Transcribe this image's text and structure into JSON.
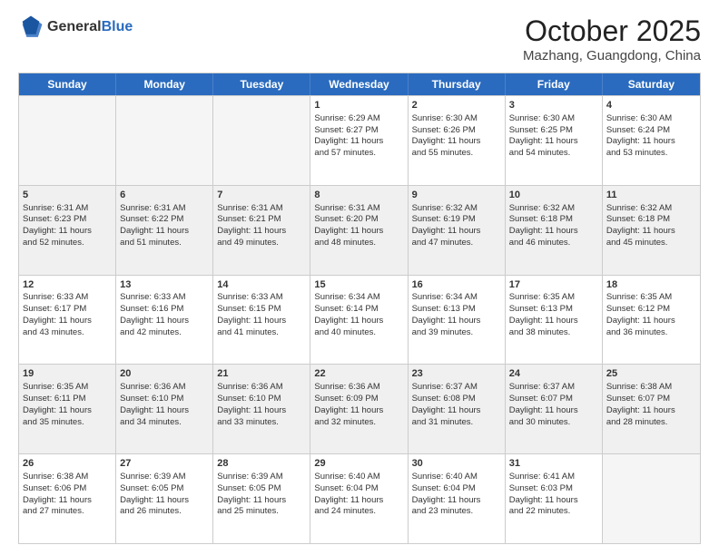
{
  "header": {
    "logo_general": "General",
    "logo_blue": "Blue",
    "month_title": "October 2025",
    "location": "Mazhang, Guangdong, China"
  },
  "weekdays": [
    "Sunday",
    "Monday",
    "Tuesday",
    "Wednesday",
    "Thursday",
    "Friday",
    "Saturday"
  ],
  "rows": [
    [
      {
        "day": "",
        "info": "",
        "empty": true
      },
      {
        "day": "",
        "info": "",
        "empty": true
      },
      {
        "day": "",
        "info": "",
        "empty": true
      },
      {
        "day": "1",
        "info": "Sunrise: 6:29 AM\nSunset: 6:27 PM\nDaylight: 11 hours\nand 57 minutes.",
        "empty": false
      },
      {
        "day": "2",
        "info": "Sunrise: 6:30 AM\nSunset: 6:26 PM\nDaylight: 11 hours\nand 55 minutes.",
        "empty": false
      },
      {
        "day": "3",
        "info": "Sunrise: 6:30 AM\nSunset: 6:25 PM\nDaylight: 11 hours\nand 54 minutes.",
        "empty": false
      },
      {
        "day": "4",
        "info": "Sunrise: 6:30 AM\nSunset: 6:24 PM\nDaylight: 11 hours\nand 53 minutes.",
        "empty": false
      }
    ],
    [
      {
        "day": "5",
        "info": "Sunrise: 6:31 AM\nSunset: 6:23 PM\nDaylight: 11 hours\nand 52 minutes.",
        "empty": false
      },
      {
        "day": "6",
        "info": "Sunrise: 6:31 AM\nSunset: 6:22 PM\nDaylight: 11 hours\nand 51 minutes.",
        "empty": false
      },
      {
        "day": "7",
        "info": "Sunrise: 6:31 AM\nSunset: 6:21 PM\nDaylight: 11 hours\nand 49 minutes.",
        "empty": false
      },
      {
        "day": "8",
        "info": "Sunrise: 6:31 AM\nSunset: 6:20 PM\nDaylight: 11 hours\nand 48 minutes.",
        "empty": false
      },
      {
        "day": "9",
        "info": "Sunrise: 6:32 AM\nSunset: 6:19 PM\nDaylight: 11 hours\nand 47 minutes.",
        "empty": false
      },
      {
        "day": "10",
        "info": "Sunrise: 6:32 AM\nSunset: 6:18 PM\nDaylight: 11 hours\nand 46 minutes.",
        "empty": false
      },
      {
        "day": "11",
        "info": "Sunrise: 6:32 AM\nSunset: 6:18 PM\nDaylight: 11 hours\nand 45 minutes.",
        "empty": false
      }
    ],
    [
      {
        "day": "12",
        "info": "Sunrise: 6:33 AM\nSunset: 6:17 PM\nDaylight: 11 hours\nand 43 minutes.",
        "empty": false
      },
      {
        "day": "13",
        "info": "Sunrise: 6:33 AM\nSunset: 6:16 PM\nDaylight: 11 hours\nand 42 minutes.",
        "empty": false
      },
      {
        "day": "14",
        "info": "Sunrise: 6:33 AM\nSunset: 6:15 PM\nDaylight: 11 hours\nand 41 minutes.",
        "empty": false
      },
      {
        "day": "15",
        "info": "Sunrise: 6:34 AM\nSunset: 6:14 PM\nDaylight: 11 hours\nand 40 minutes.",
        "empty": false
      },
      {
        "day": "16",
        "info": "Sunrise: 6:34 AM\nSunset: 6:13 PM\nDaylight: 11 hours\nand 39 minutes.",
        "empty": false
      },
      {
        "day": "17",
        "info": "Sunrise: 6:35 AM\nSunset: 6:13 PM\nDaylight: 11 hours\nand 38 minutes.",
        "empty": false
      },
      {
        "day": "18",
        "info": "Sunrise: 6:35 AM\nSunset: 6:12 PM\nDaylight: 11 hours\nand 36 minutes.",
        "empty": false
      }
    ],
    [
      {
        "day": "19",
        "info": "Sunrise: 6:35 AM\nSunset: 6:11 PM\nDaylight: 11 hours\nand 35 minutes.",
        "empty": false
      },
      {
        "day": "20",
        "info": "Sunrise: 6:36 AM\nSunset: 6:10 PM\nDaylight: 11 hours\nand 34 minutes.",
        "empty": false
      },
      {
        "day": "21",
        "info": "Sunrise: 6:36 AM\nSunset: 6:10 PM\nDaylight: 11 hours\nand 33 minutes.",
        "empty": false
      },
      {
        "day": "22",
        "info": "Sunrise: 6:36 AM\nSunset: 6:09 PM\nDaylight: 11 hours\nand 32 minutes.",
        "empty": false
      },
      {
        "day": "23",
        "info": "Sunrise: 6:37 AM\nSunset: 6:08 PM\nDaylight: 11 hours\nand 31 minutes.",
        "empty": false
      },
      {
        "day": "24",
        "info": "Sunrise: 6:37 AM\nSunset: 6:07 PM\nDaylight: 11 hours\nand 30 minutes.",
        "empty": false
      },
      {
        "day": "25",
        "info": "Sunrise: 6:38 AM\nSunset: 6:07 PM\nDaylight: 11 hours\nand 28 minutes.",
        "empty": false
      }
    ],
    [
      {
        "day": "26",
        "info": "Sunrise: 6:38 AM\nSunset: 6:06 PM\nDaylight: 11 hours\nand 27 minutes.",
        "empty": false
      },
      {
        "day": "27",
        "info": "Sunrise: 6:39 AM\nSunset: 6:05 PM\nDaylight: 11 hours\nand 26 minutes.",
        "empty": false
      },
      {
        "day": "28",
        "info": "Sunrise: 6:39 AM\nSunset: 6:05 PM\nDaylight: 11 hours\nand 25 minutes.",
        "empty": false
      },
      {
        "day": "29",
        "info": "Sunrise: 6:40 AM\nSunset: 6:04 PM\nDaylight: 11 hours\nand 24 minutes.",
        "empty": false
      },
      {
        "day": "30",
        "info": "Sunrise: 6:40 AM\nSunset: 6:04 PM\nDaylight: 11 hours\nand 23 minutes.",
        "empty": false
      },
      {
        "day": "31",
        "info": "Sunrise: 6:41 AM\nSunset: 6:03 PM\nDaylight: 11 hours\nand 22 minutes.",
        "empty": false
      },
      {
        "day": "",
        "info": "",
        "empty": true
      }
    ]
  ]
}
